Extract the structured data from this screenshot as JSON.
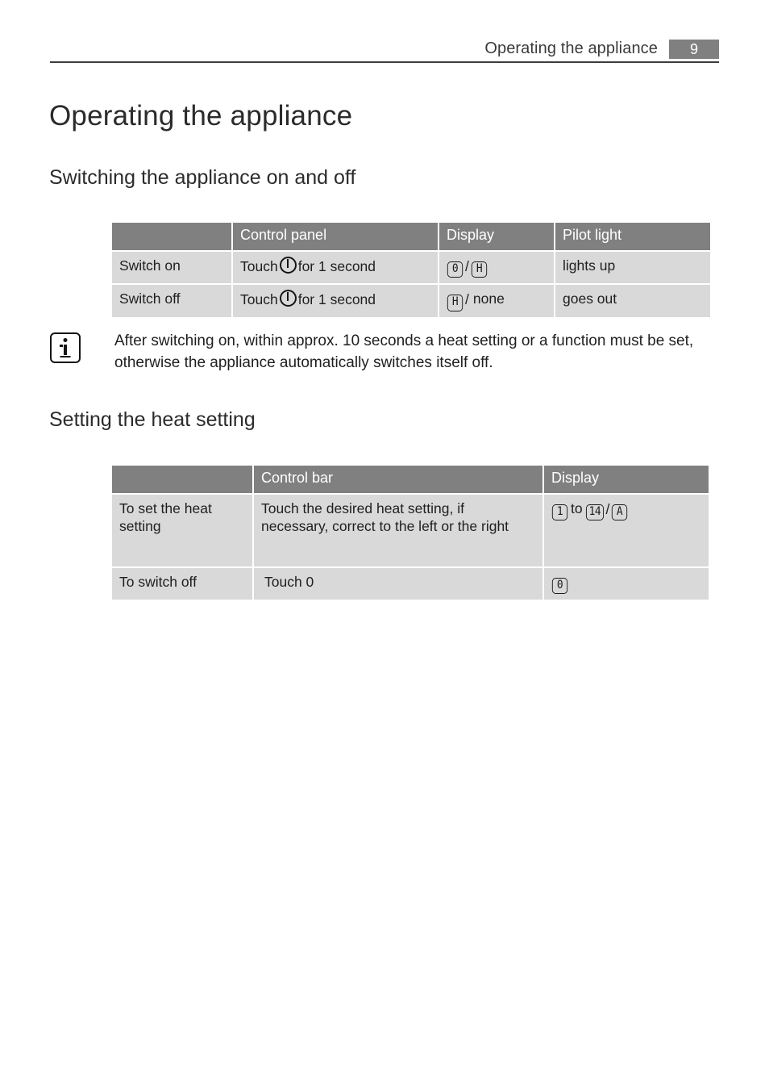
{
  "header": {
    "title": "Operating the appliance",
    "page_number": "9"
  },
  "headings": {
    "h1": "Operating the appliance",
    "section_switching": "Switching the appliance on and off",
    "section_heat": "Setting the heat setting"
  },
  "table_switching": {
    "columns": [
      "",
      "Control panel",
      "Display",
      "Pilot light"
    ],
    "rows": [
      {
        "action": "Switch on",
        "control_prefix": "Touch",
        "control_suffix": "for 1 second",
        "control_icon": "power-icon",
        "display": {
          "first": "0",
          "separator": "/",
          "second": "H"
        },
        "pilot": "lights up"
      },
      {
        "action": "Switch off",
        "control_prefix": "Touch",
        "control_suffix": "for 1 second",
        "control_icon": "power-icon",
        "display": {
          "first": "H",
          "separator": "/",
          "second_word": "none"
        },
        "pilot": "goes out"
      }
    ]
  },
  "note": {
    "icon": "info-icon",
    "text": "After switching on, within approx. 10 seconds a heat setting or a function must be set, otherwise the appliance automatically switches itself off."
  },
  "table_heat": {
    "columns": [
      "",
      "Control bar",
      "Display"
    ],
    "rows": [
      {
        "action": "To set the heat setting",
        "control": "Touch the desired heat setting, if necessary, correct to the left or the right",
        "display": {
          "first": "1",
          "word": "to",
          "second": "14",
          "separator": "/",
          "third": "A"
        }
      },
      {
        "action": "To switch off",
        "control": "Touch 0",
        "display": {
          "first": "0"
        }
      }
    ]
  },
  "colors": {
    "header_band": "#808080",
    "cell_bg": "#d9d9d9",
    "text": "#1f1f1f",
    "rule": "#3c3c3c"
  }
}
